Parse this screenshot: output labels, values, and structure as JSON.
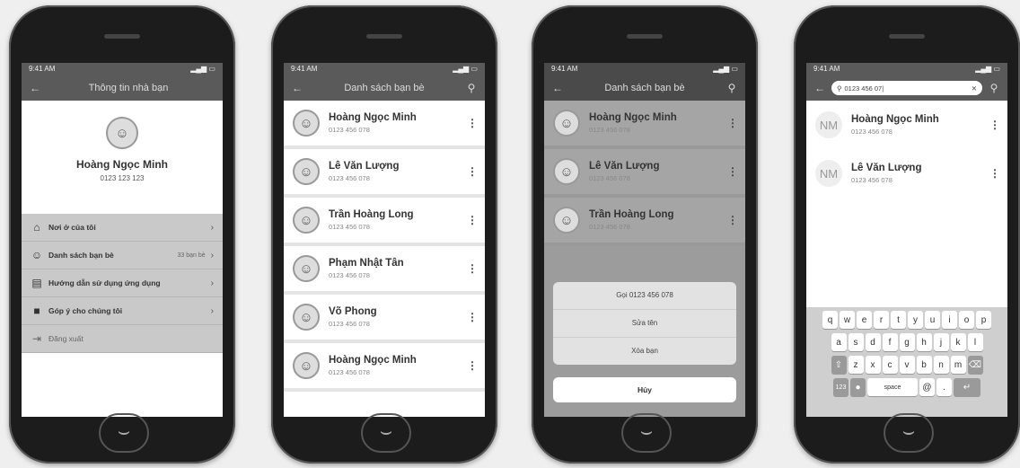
{
  "phone1": {
    "status_time": "9:41 AM",
    "title": "Thông tin nhà bạn",
    "profile": {
      "name": "Hoàng Ngọc Minh",
      "phone": "0123 123 123"
    },
    "menu": [
      {
        "icon": "home-icon",
        "glyph": "⌂",
        "label": "Nơi ở của tôi",
        "right": ""
      },
      {
        "icon": "people-icon",
        "glyph": "☺",
        "label": "Danh sách bạn bè",
        "right": "33 bạn bè"
      },
      {
        "icon": "guide-icon",
        "glyph": "▤",
        "label": "Hướng dẫn sử dụng ứng dụng",
        "right": ""
      },
      {
        "icon": "feedback-icon",
        "glyph": "■",
        "label": "Góp ý cho chúng tôi",
        "right": ""
      },
      {
        "icon": "logout-icon",
        "glyph": "⇥",
        "label": "Đăng xuất",
        "right": ""
      }
    ]
  },
  "phone2": {
    "status_time": "9:41 AM",
    "title": "Danh sách bạn bè",
    "friends": [
      {
        "name": "Hoàng Ngọc Minh",
        "phone": "0123 456 078"
      },
      {
        "name": "Lê Văn Lượng",
        "phone": "0123 456 078"
      },
      {
        "name": "Trần Hoàng Long",
        "phone": "0123 456 078"
      },
      {
        "name": "Phạm Nhật Tân",
        "phone": "0123 456 078"
      },
      {
        "name": "Võ Phong",
        "phone": "0123 456 078"
      },
      {
        "name": "Hoàng Ngọc Minh",
        "phone": "0123 456 078"
      }
    ]
  },
  "phone3": {
    "status_time": "9:41 AM",
    "title": "Danh sách bạn bè",
    "friends": [
      {
        "name": "Hoàng Ngọc Minh",
        "phone": "0123 456 078"
      },
      {
        "name": "Lê Văn Lượng",
        "phone": "0123 456 078"
      },
      {
        "name": "Trần Hoàng Long",
        "phone": "0123 456 078"
      }
    ],
    "sheet": {
      "call": "Gọi 0123 456 078",
      "rename": "Sửa tên",
      "remove": "Xóa bạn",
      "cancel": "Hủy"
    },
    "footer_phone": "0123 456 078"
  },
  "phone4": {
    "status_time": "9:41 AM",
    "search_value": "0123 456 07|",
    "results": [
      {
        "initials": "NM",
        "name": "Hoàng Ngọc Minh",
        "phone": "0123 456 078"
      },
      {
        "initials": "NM",
        "name": "Lê Văn Lượng",
        "phone": "0123 456 078"
      }
    ],
    "keyboard": {
      "row1": [
        "q",
        "w",
        "e",
        "r",
        "t",
        "y",
        "u",
        "i",
        "o",
        "p"
      ],
      "row2": [
        "a",
        "s",
        "d",
        "f",
        "g",
        "h",
        "j",
        "k",
        "l"
      ],
      "row3": [
        "z",
        "x",
        "c",
        "v",
        "b",
        "n",
        "m"
      ],
      "num_key": "123",
      "space_key": "space",
      "at_key": "@",
      "dot_key": "."
    }
  }
}
